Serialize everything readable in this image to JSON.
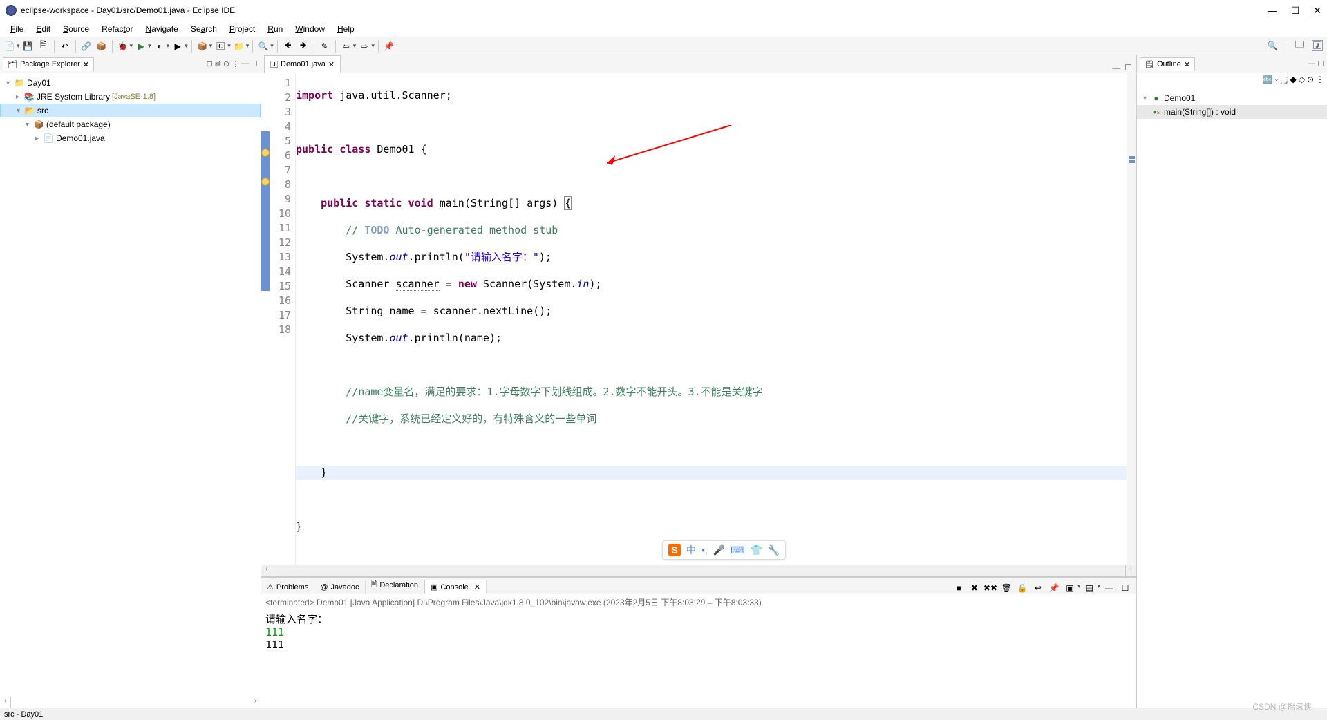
{
  "window": {
    "title": "eclipse-workspace - Day01/src/Demo01.java - Eclipse IDE"
  },
  "menu": {
    "file": "File",
    "edit": "Edit",
    "source": "Source",
    "refactor": "Refactor",
    "navigate": "Navigate",
    "search": "Search",
    "project": "Project",
    "run": "Run",
    "window": "Window",
    "help": "Help"
  },
  "package_explorer": {
    "title": "Package Explorer",
    "items": {
      "project": "Day01",
      "jre": "JRE System Library",
      "jre_ver": "[JavaSE-1.8]",
      "src": "src",
      "pkg": "(default package)",
      "file": "Demo01.java"
    }
  },
  "editor": {
    "tab": "Demo01.java",
    "lines": [
      "1",
      "2",
      "3",
      "4",
      "5",
      "6",
      "7",
      "8",
      "9",
      "10",
      "11",
      "12",
      "13",
      "14",
      "15",
      "16",
      "17",
      "18"
    ],
    "code": {
      "l1a": "import",
      "l1b": " java.util.Scanner;",
      "l3a": "public",
      "l3b": " class",
      "l3c": " Demo01 {",
      "l5a": "    public",
      "l5b": " static",
      "l5c": " void",
      "l5d": " main(String[] args) ",
      "l5e": "{",
      "l6a": "        // ",
      "l6b": "TODO",
      "l6c": " Auto-generated method stub",
      "l7a": "        System.",
      "l7b": "out",
      "l7c": ".println(",
      "l7d": "\"请输入名字：\"",
      "l7e": ");",
      "l8a": "        Scanner ",
      "l8b": "scanner",
      "l8c": " = ",
      "l8d": "new",
      "l8e": " Scanner(System.",
      "l8f": "in",
      "l8g": ");",
      "l9a": "        String name = scanner.nextLine();",
      "l10a": "        System.",
      "l10b": "out",
      "l10c": ".println(name);",
      "l12": "        //name变量名，满足的要求：1.字母数字下划线组成。2.数字不能开头。3.不能是关键字",
      "l13": "        //关键字，系统已经定义好的，有特殊含义的一些单词",
      "l15": "    }",
      "l17": "}"
    }
  },
  "console": {
    "tabs": {
      "problems": "Problems",
      "javadoc": "Javadoc",
      "declaration": "Declaration",
      "console": "Console"
    },
    "status": "<terminated> Demo01 [Java Application] D:\\Program Files\\Java\\jdk1.8.0_102\\bin\\javaw.exe (2023年2月5日 下午8:03:29 – 下午8:03:33)",
    "lines": {
      "l1": "请输入名字：",
      "l2": "111",
      "l3": "111"
    }
  },
  "outline": {
    "title": "Outline",
    "class": "Demo01",
    "method": "main(String[]) : void"
  },
  "statusbar": {
    "text": "src - Day01"
  },
  "watermark": "CSDN @摇滚侠",
  "sogo": {
    "c": "中"
  }
}
